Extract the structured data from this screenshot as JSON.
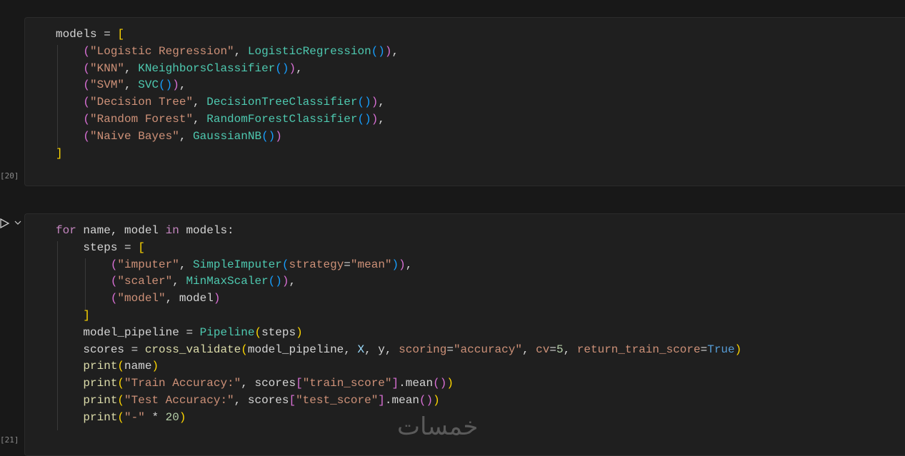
{
  "cells": [
    {
      "exec_count": "[20]",
      "lines": [
        [
          [
            "t",
            "models "
          ],
          [
            "t",
            "= "
          ],
          [
            "br1",
            "["
          ]
        ],
        [
          [
            "t",
            "    "
          ],
          [
            "br2",
            "("
          ],
          [
            "s",
            "\"Logistic Regression\""
          ],
          [
            "t",
            ", "
          ],
          [
            "c",
            "LogisticRegression"
          ],
          [
            "br3",
            "()"
          ],
          [
            "br2",
            ")"
          ],
          [
            "t",
            ","
          ]
        ],
        [
          [
            "t",
            "    "
          ],
          [
            "br2",
            "("
          ],
          [
            "s",
            "\"KNN\""
          ],
          [
            "t",
            ", "
          ],
          [
            "c",
            "KNeighborsClassifier"
          ],
          [
            "br3",
            "()"
          ],
          [
            "br2",
            ")"
          ],
          [
            "t",
            ","
          ]
        ],
        [
          [
            "t",
            "    "
          ],
          [
            "br2",
            "("
          ],
          [
            "s",
            "\"SVM\""
          ],
          [
            "t",
            ", "
          ],
          [
            "c",
            "SVC"
          ],
          [
            "br3",
            "()"
          ],
          [
            "br2",
            ")"
          ],
          [
            "t",
            ","
          ]
        ],
        [
          [
            "t",
            "    "
          ],
          [
            "br2",
            "("
          ],
          [
            "s",
            "\"Decision Tree\""
          ],
          [
            "t",
            ", "
          ],
          [
            "c",
            "DecisionTreeClassifier"
          ],
          [
            "br3",
            "()"
          ],
          [
            "br2",
            ")"
          ],
          [
            "t",
            ","
          ]
        ],
        [
          [
            "t",
            "    "
          ],
          [
            "br2",
            "("
          ],
          [
            "s",
            "\"Random Forest\""
          ],
          [
            "t",
            ", "
          ],
          [
            "c",
            "RandomForestClassifier"
          ],
          [
            "br3",
            "()"
          ],
          [
            "br2",
            ")"
          ],
          [
            "t",
            ","
          ]
        ],
        [
          [
            "t",
            "    "
          ],
          [
            "br2",
            "("
          ],
          [
            "s",
            "\"Naive Bayes\""
          ],
          [
            "t",
            ", "
          ],
          [
            "c",
            "GaussianNB"
          ],
          [
            "br3",
            "()"
          ],
          [
            "br2",
            ")"
          ]
        ],
        [
          [
            "br1",
            "]"
          ]
        ]
      ]
    },
    {
      "exec_count": "[21]",
      "lines": [
        [
          [
            "k",
            "for "
          ],
          [
            "t",
            "name, model "
          ],
          [
            "k",
            "in "
          ],
          [
            "t",
            "models:"
          ]
        ],
        [
          [
            "t",
            "    steps "
          ],
          [
            "t",
            "= "
          ],
          [
            "br1",
            "["
          ]
        ],
        [
          [
            "t",
            "        "
          ],
          [
            "br2",
            "("
          ],
          [
            "s",
            "\"imputer\""
          ],
          [
            "t",
            ", "
          ],
          [
            "c",
            "SimpleImputer"
          ],
          [
            "br3",
            "("
          ],
          [
            "p",
            "strategy"
          ],
          [
            "t",
            "="
          ],
          [
            "s",
            "\"mean\""
          ],
          [
            "br3",
            ")"
          ],
          [
            "br2",
            ")"
          ],
          [
            "t",
            ","
          ]
        ],
        [
          [
            "t",
            "        "
          ],
          [
            "br2",
            "("
          ],
          [
            "s",
            "\"scaler\""
          ],
          [
            "t",
            ", "
          ],
          [
            "c",
            "MinMaxScaler"
          ],
          [
            "br3",
            "()"
          ],
          [
            "br2",
            ")"
          ],
          [
            "t",
            ","
          ]
        ],
        [
          [
            "t",
            "        "
          ],
          [
            "br2",
            "("
          ],
          [
            "s",
            "\"model\""
          ],
          [
            "t",
            ", model"
          ],
          [
            "br2",
            ")"
          ]
        ],
        [
          [
            "t",
            "    "
          ],
          [
            "br1",
            "]"
          ]
        ],
        [
          [
            "t",
            "    model_pipeline "
          ],
          [
            "t",
            "= "
          ],
          [
            "c",
            "Pipeline"
          ],
          [
            "br1",
            "("
          ],
          [
            "t",
            "steps"
          ],
          [
            "br1",
            ")"
          ]
        ],
        [
          [
            "t",
            "    scores "
          ],
          [
            "t",
            "= "
          ],
          [
            "f",
            "cross_validate"
          ],
          [
            "br1",
            "("
          ],
          [
            "t",
            "model_pipeline, "
          ],
          [
            "v",
            "X"
          ],
          [
            "t",
            ", y, "
          ],
          [
            "p",
            "scoring"
          ],
          [
            "t",
            "="
          ],
          [
            "s",
            "\"accuracy\""
          ],
          [
            "t",
            ", "
          ],
          [
            "p",
            "cv"
          ],
          [
            "t",
            "="
          ],
          [
            "n",
            "5"
          ],
          [
            "t",
            ", "
          ],
          [
            "p",
            "return_train_score"
          ],
          [
            "t",
            "="
          ],
          [
            "b",
            "True"
          ],
          [
            "br1",
            ")"
          ]
        ],
        [
          [
            "t",
            "    "
          ],
          [
            "f",
            "print"
          ],
          [
            "br1",
            "("
          ],
          [
            "t",
            "name"
          ],
          [
            "br1",
            ")"
          ]
        ],
        [
          [
            "t",
            "    "
          ],
          [
            "f",
            "print"
          ],
          [
            "br1",
            "("
          ],
          [
            "s",
            "\"Train Accuracy:\""
          ],
          [
            "t",
            ", scores"
          ],
          [
            "br2",
            "["
          ],
          [
            "s",
            "\"train_score\""
          ],
          [
            "br2",
            "]"
          ],
          [
            "t",
            ".mean"
          ],
          [
            "br2",
            "()"
          ],
          [
            "br1",
            ")"
          ]
        ],
        [
          [
            "t",
            "    "
          ],
          [
            "f",
            "print"
          ],
          [
            "br1",
            "("
          ],
          [
            "s",
            "\"Test Accuracy:\""
          ],
          [
            "t",
            ", scores"
          ],
          [
            "br2",
            "["
          ],
          [
            "s",
            "\"test_score\""
          ],
          [
            "br2",
            "]"
          ],
          [
            "t",
            ".mean"
          ],
          [
            "br2",
            "()"
          ],
          [
            "br1",
            ")"
          ]
        ],
        [
          [
            "t",
            "    "
          ],
          [
            "f",
            "print"
          ],
          [
            "br1",
            "("
          ],
          [
            "s",
            "\"-\""
          ],
          [
            "t",
            " * "
          ],
          [
            "n",
            "20"
          ],
          [
            "br1",
            ")"
          ]
        ]
      ]
    }
  ],
  "watermark": "خمسات",
  "icons": {
    "run": "run-cell-icon",
    "collapse": "chevron-down-icon"
  }
}
